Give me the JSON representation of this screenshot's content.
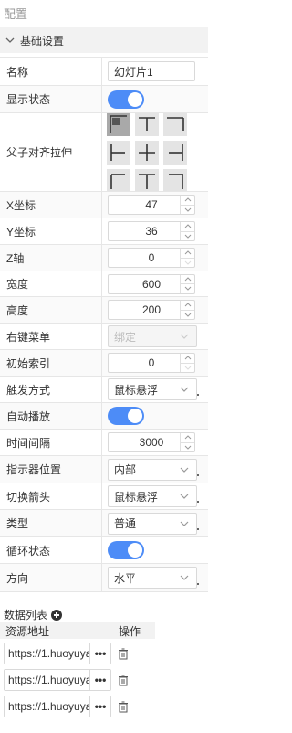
{
  "panel_title": "配置",
  "section": {
    "label": "基础设置"
  },
  "props": {
    "name": {
      "label": "名称",
      "value": "幻灯片1"
    },
    "visible": {
      "label": "显示状态",
      "on": true
    },
    "align": {
      "label": "父子对齐拉伸"
    },
    "x": {
      "label": "X坐标",
      "value": "47"
    },
    "y": {
      "label": "Y坐标",
      "value": "36"
    },
    "z": {
      "label": "Z轴",
      "value": "0"
    },
    "width": {
      "label": "宽度",
      "value": "600"
    },
    "height": {
      "label": "高度",
      "value": "200"
    },
    "context_menu": {
      "label": "右键菜单",
      "value": "绑定"
    },
    "initial_index": {
      "label": "初始索引",
      "value": "0"
    },
    "trigger": {
      "label": "触发方式",
      "value": "鼠标悬浮"
    },
    "autoplay": {
      "label": "自动播放",
      "on": true
    },
    "interval": {
      "label": "时间间隔",
      "value": "3000"
    },
    "indicator": {
      "label": "指示器位置",
      "value": "内部"
    },
    "arrow": {
      "label": "切换箭头",
      "value": "鼠标悬浮"
    },
    "type": {
      "label": "类型",
      "value": "普通"
    },
    "loop": {
      "label": "循环状态",
      "on": true
    },
    "direction": {
      "label": "方向",
      "value": "水平"
    }
  },
  "data_list": {
    "title": "数据列表",
    "col_source": "资源地址",
    "col_action": "操作",
    "rows": [
      {
        "url": "https://1.huoyuya"
      },
      {
        "url": "https://1.huoyuya"
      },
      {
        "url": "https://1.huoyuya"
      }
    ],
    "more_label": "•••"
  },
  "colors": {
    "accent": "#4d8cf7",
    "border": "#d9d9d9",
    "header_bg": "#f2f2f2"
  }
}
